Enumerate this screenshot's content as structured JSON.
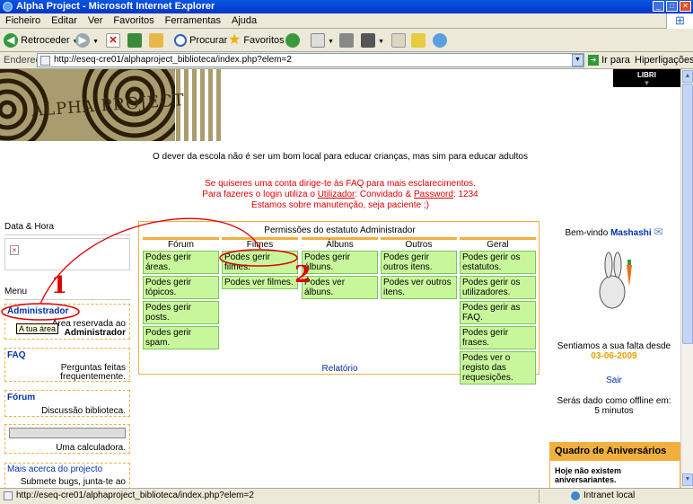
{
  "window": {
    "title": "Alpha Project - Microsoft Internet Explorer"
  },
  "menu": [
    "Ficheiro",
    "Editar",
    "Ver",
    "Favoritos",
    "Ferramentas",
    "Ajuda"
  ],
  "toolbar": {
    "back": "Retroceder",
    "search": "Procurar",
    "favorites": "Favoritos"
  },
  "address": {
    "label": "Endereço",
    "url": "http://eseq-cre01/alphaproject_biblioteca/index.php?elem=2",
    "go": "Ir para",
    "links": "Hiperligações"
  },
  "header": {
    "banner_title": "ALPHA PROJECT",
    "libri": "LIBRI",
    "quote": "O dever da escola não é ser um bom local para educar crianças, mas sim para educar adultos"
  },
  "notice": {
    "line1": "Se quiseres uma conta dirige-te às FAQ para mais esclarecimentos.",
    "line2_pre": "Para fazeres o login utiliza o ",
    "line2_user": "Utilizador",
    "line2_mid": ": Convidado & ",
    "line2_pass": "Password",
    "line2_post": ": 1234",
    "line3": "Estamos sobre manutenção, seja paciente ;)"
  },
  "left": {
    "datetime": "Data & Hora",
    "menu": "Menu",
    "admin_title": "Administrador",
    "admin_tooltip": "A tua área",
    "admin_desc1": "Área reservada ao",
    "admin_desc2": "Administrador",
    "faq_title": "FAQ",
    "faq_desc1": "Perguntas feitas",
    "faq_desc2": "frequentemente.",
    "forum_title": "Fórum",
    "forum_desc": "Discussão biblioteca.",
    "calc_desc": "Uma calculadora.",
    "more_title": "Mais acerca do projecto",
    "more_desc": "Submete bugs, junta-te ao"
  },
  "annotations": {
    "n1": "1",
    "n2": "2"
  },
  "permissions": {
    "title": "Permissões do estatuto Administrador",
    "columns": [
      {
        "name": "Fórum",
        "items": [
          "Podes gerir áreas.",
          "Podes gerir tópicos.",
          "Podes gerir posts.",
          "Podes gerir spam."
        ]
      },
      {
        "name": "Filmes",
        "items": [
          "Podes gerir filmes.",
          "Podes ver filmes."
        ]
      },
      {
        "name": "Álbuns",
        "items": [
          "Podes gerir álbuns.",
          "Podes ver álbuns."
        ]
      },
      {
        "name": "Outros",
        "items": [
          "Podes gerir outros itens.",
          "Podes ver outros itens."
        ]
      },
      {
        "name": "Geral",
        "items": [
          "Podes gerir os estatutos.",
          "Podes gerir os utilizadores.",
          "Podes gerir as FAQ.",
          "Podes gerir frases.",
          "Podes ver o registo das requesições."
        ]
      }
    ],
    "report": "Relatório"
  },
  "right": {
    "welcome": "Bem-vindo ",
    "user": "Mashashi",
    "miss": "Sentiamos a sua falta desde",
    "date": "03-06-2009",
    "logout": "Sair",
    "offline1": "Serás dado como offline em:",
    "offline2": "5 minutos",
    "bday_title": "Quadro de Aniversários",
    "bday_text": "Hoje não existem aniversariantes."
  },
  "status": {
    "url": "http://eseq-cre01/alphaproject_biblioteca/index.php?elem=2",
    "zone": "Intranet local"
  },
  "colors": {
    "accent": "#f0b040",
    "perm_bg": "#c8f79b",
    "link": "#0033aa",
    "red": "#e00000"
  }
}
